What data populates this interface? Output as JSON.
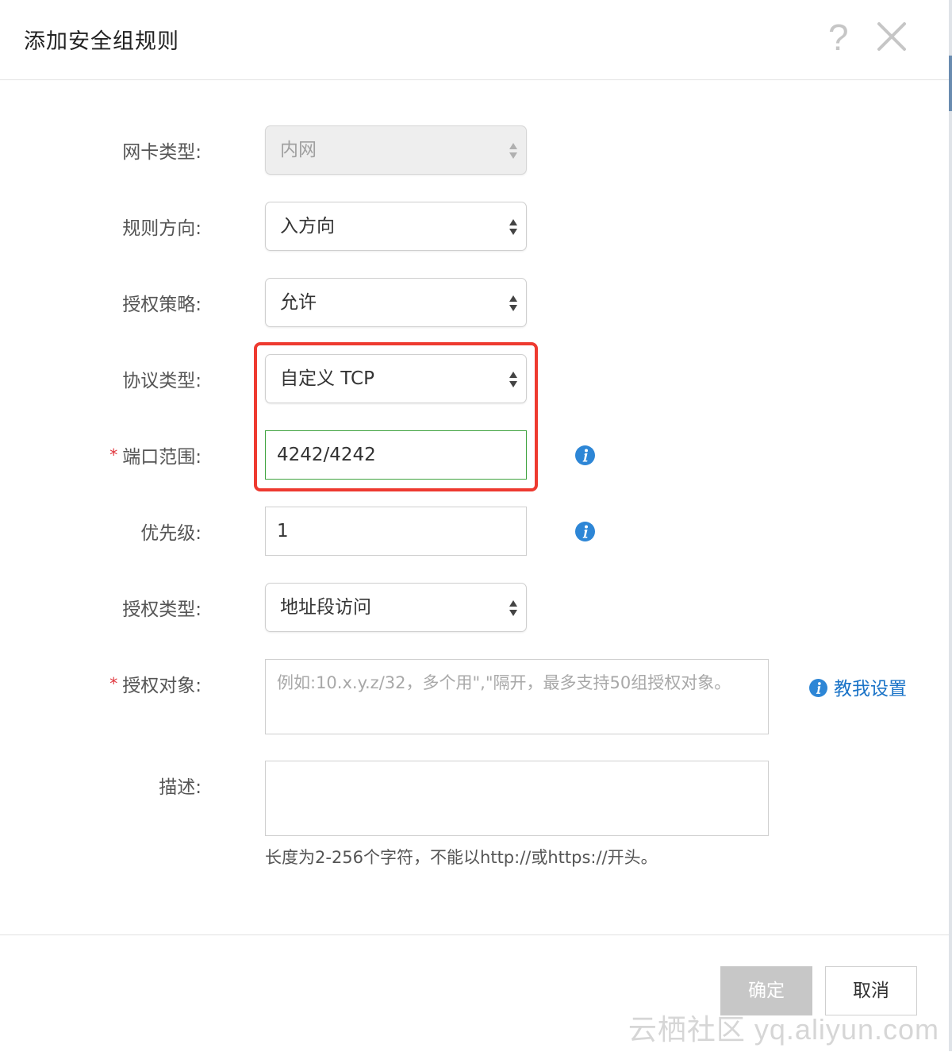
{
  "dialog": {
    "title": "添加安全组规则",
    "help_icon": "?"
  },
  "form": {
    "nic_type": {
      "label": "网卡类型:",
      "value": "内网",
      "disabled": true
    },
    "direction": {
      "label": "规则方向:",
      "value": "入方向"
    },
    "policy": {
      "label": "授权策略:",
      "value": "允许"
    },
    "protocol": {
      "label": "协议类型:",
      "value": "自定义 TCP"
    },
    "port_range": {
      "label": "端口范围:",
      "required": "*",
      "value": "4242/4242"
    },
    "priority": {
      "label": "优先级:",
      "value": "1"
    },
    "auth_type": {
      "label": "授权类型:",
      "value": "地址段访问"
    },
    "auth_object": {
      "label": "授权对象:",
      "required": "*",
      "placeholder": "例如:10.x.y.z/32，多个用\",\"隔开，最多支持50组授权对象。",
      "help_link": "教我设置"
    },
    "description": {
      "label": "描述:",
      "value": "",
      "hint": "长度为2-256个字符，不能以http://或https://开头。"
    }
  },
  "footer": {
    "ok_label": "确定",
    "cancel_label": "取消"
  },
  "watermark": "云栖社区 yq.aliyun.com",
  "colors": {
    "highlight": "#ee3a30",
    "link": "#1a73c7",
    "info_icon": "#2d86d6",
    "valid_border": "#3fa33f",
    "required": "#e0353c"
  },
  "icons": [
    "help-icon",
    "close-icon",
    "select-arrows-icon",
    "info-icon"
  ]
}
